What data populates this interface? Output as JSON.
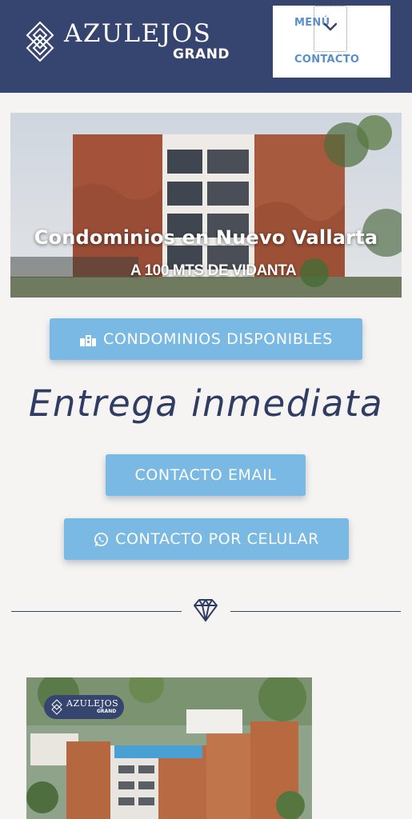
{
  "header": {
    "logo_title": "AZULEJOS",
    "logo_sub": "GRAND",
    "nav_menu": "MENÚ",
    "nav_contacto": "CONTACTO",
    "toggle_icon": "chevron-down-icon"
  },
  "hero": {
    "title": "Condominios en Nuevo Vallarta",
    "subtitle": "A 100 MTS DE VIDANTA"
  },
  "buttons": {
    "condominios": "CONDOMINIOS DISPONIBLES",
    "contacto_email": "CONTACTO EMAIL",
    "contacto_celular": "CONTACTO POR CELULAR"
  },
  "headline": "Entrega inmediata",
  "divider_icon": "diamond-icon",
  "render": {
    "badge_title": "AZULEJOS",
    "badge_sub": "GRAND"
  },
  "colors": {
    "header_bg": "#36456f",
    "button_bg": "#7ab9e3",
    "text_dark": "#2f3c63",
    "link": "#5a8fc7"
  }
}
